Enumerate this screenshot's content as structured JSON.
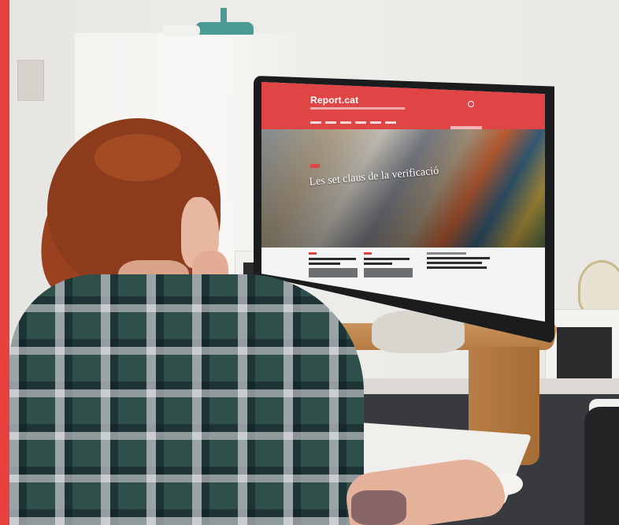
{
  "photo": {
    "description_icon": "woman-at-desk-photo",
    "accent_color": "#e8403f"
  },
  "website": {
    "logo_text": "Report.cat",
    "hero_title": "Les set claus de la verificació",
    "brand_color": "#e04546"
  }
}
